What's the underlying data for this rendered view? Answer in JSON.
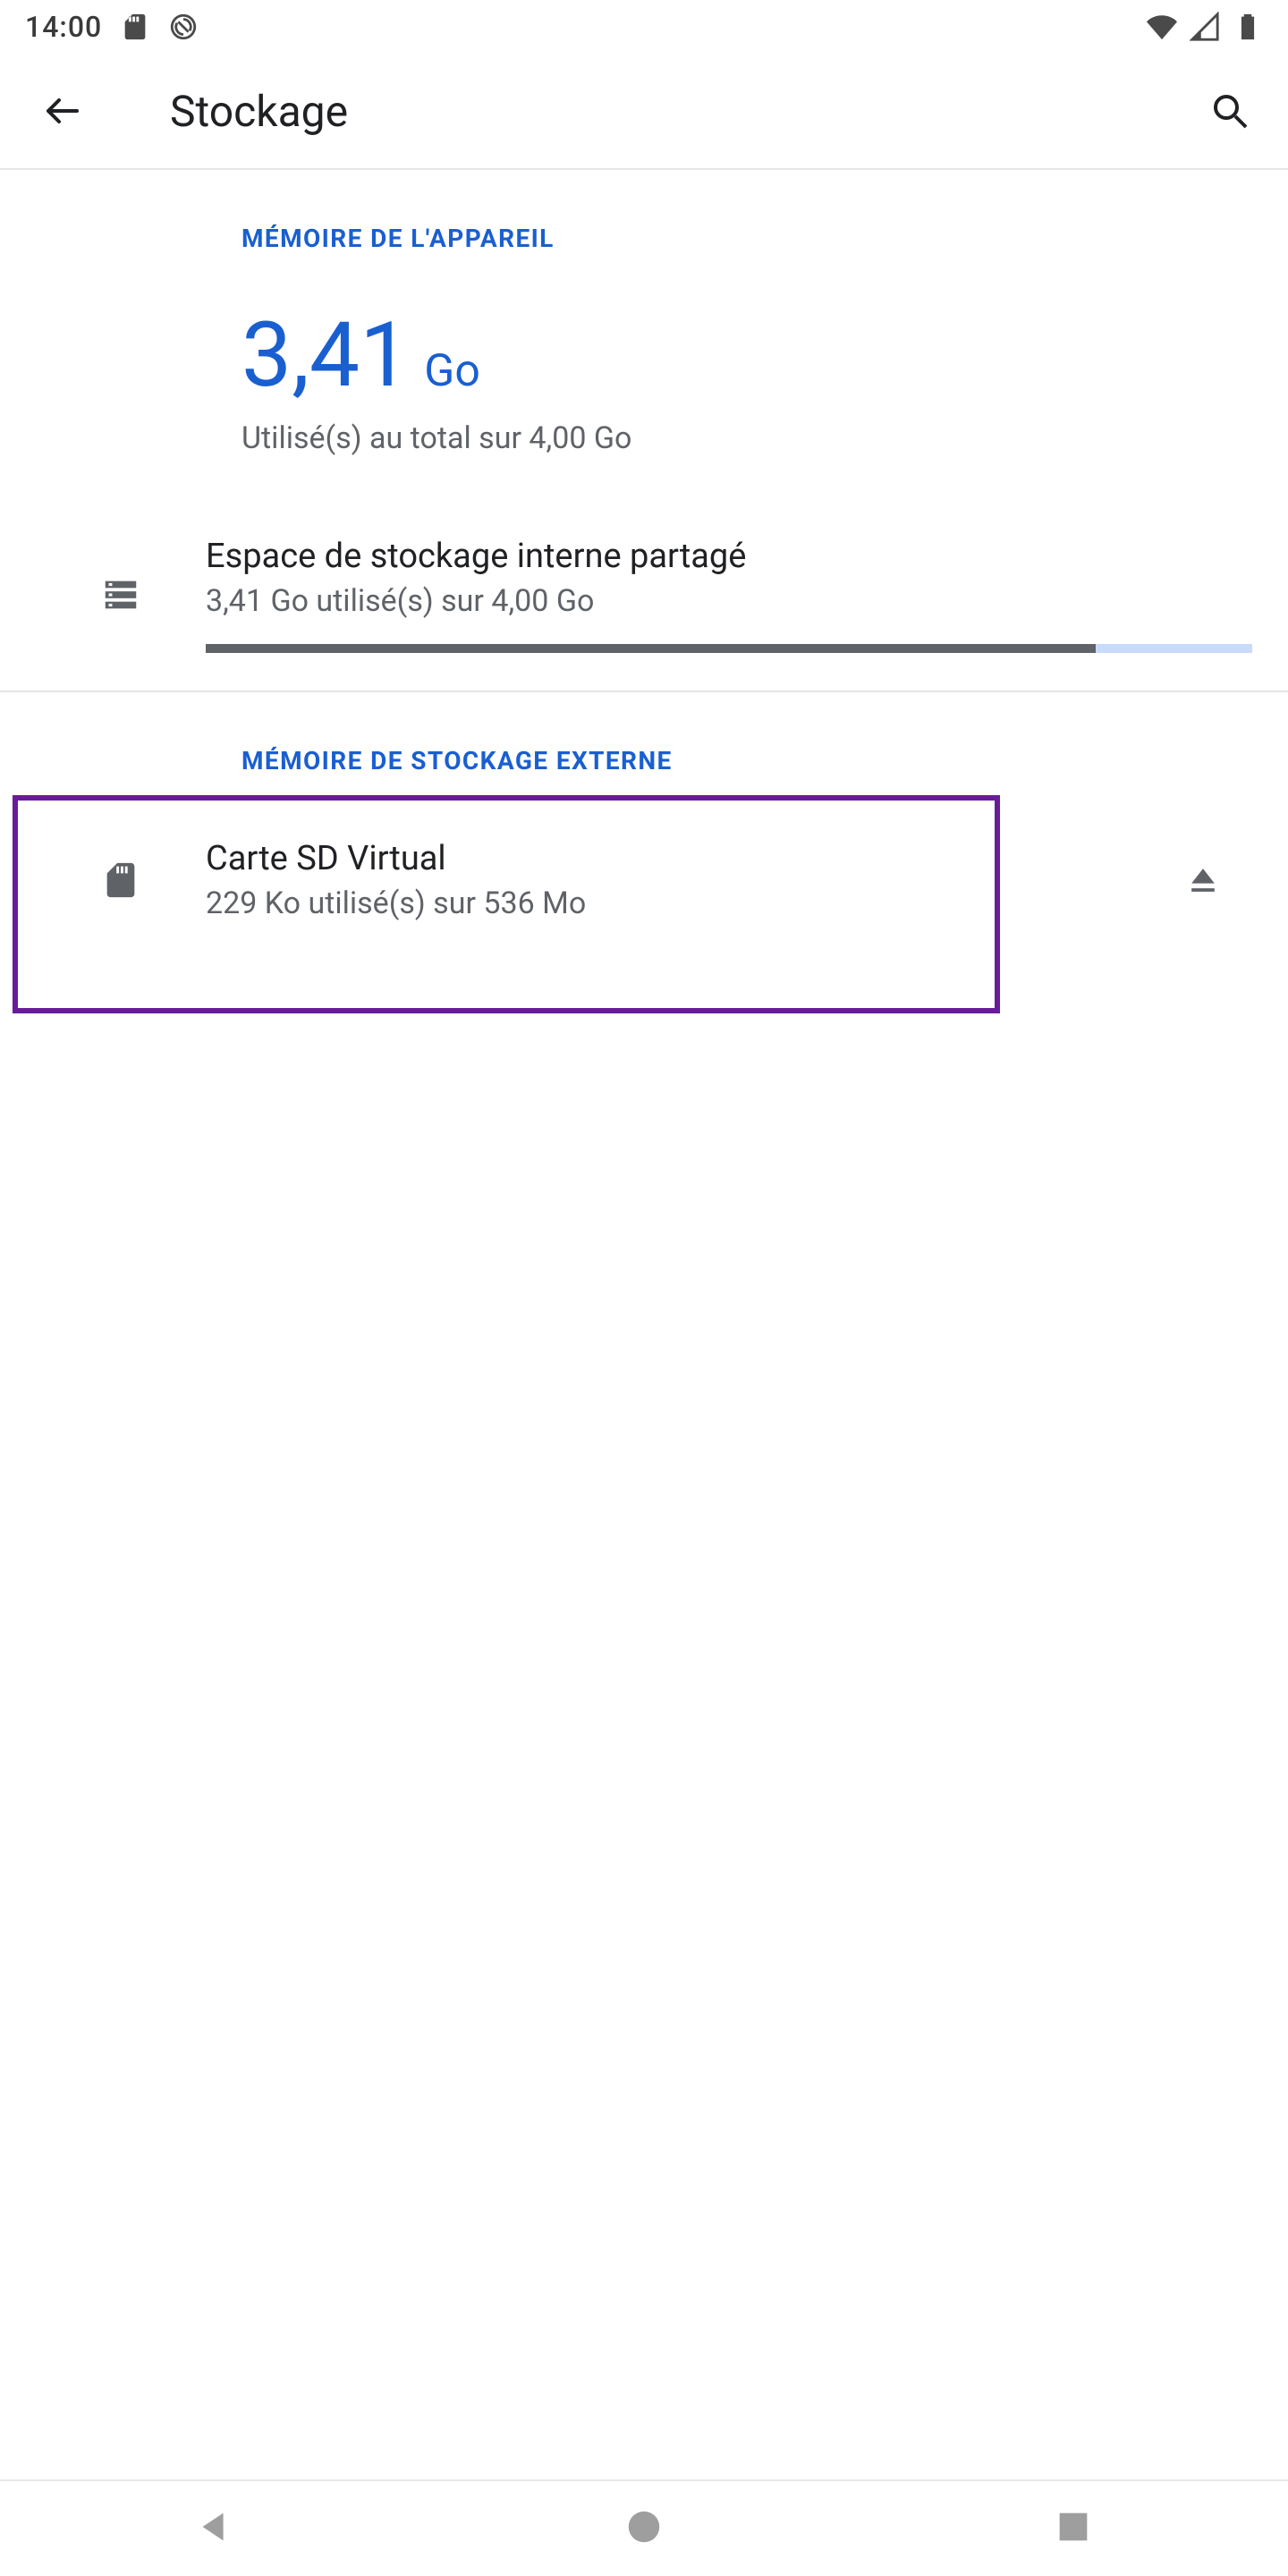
{
  "status": {
    "time": "14:00"
  },
  "header": {
    "title": "Stockage"
  },
  "device": {
    "section_label": "MÉMOIRE DE L'APPAREIL",
    "used_value": "3,41",
    "used_unit": "Go",
    "used_sub": "Utilisé(s) au total sur 4,00 Go",
    "internal": {
      "title": "Espace de stockage interne partagé",
      "sub": "3,41 Go utilisé(s) sur 4,00 Go",
      "progress_percent": 85
    }
  },
  "external": {
    "section_label": "MÉMOIRE DE STOCKAGE EXTERNE",
    "sd": {
      "title": "Carte SD Virtual",
      "sub": "229 Ko utilisé(s) sur 536 Mo"
    }
  }
}
